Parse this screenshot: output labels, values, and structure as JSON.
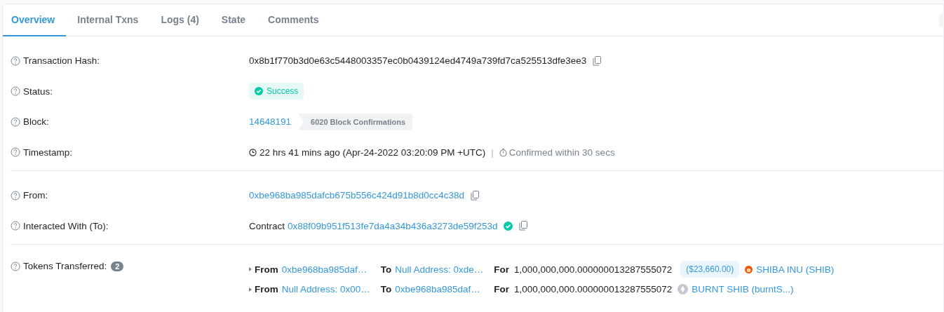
{
  "tabs": [
    {
      "label": "Overview",
      "selected": true
    },
    {
      "label": "Internal Txns",
      "selected": false
    },
    {
      "label": "Logs (4)",
      "selected": false
    },
    {
      "label": "State",
      "selected": false
    },
    {
      "label": "Comments",
      "selected": false
    }
  ],
  "sections": [
    {
      "rows": [
        {
          "label": "Transaction Hash:",
          "kind": "hash",
          "value": "0x8b1f770b3d0e63c5448003357ec0b0439124ed4749a739fd7ca525513dfe3ee3"
        },
        {
          "label": "Status:",
          "kind": "status",
          "value": "Success"
        },
        {
          "label": "Block:",
          "kind": "block",
          "value": "14648191",
          "confirmations": "6020 Block Confirmations"
        },
        {
          "label": "Timestamp:",
          "kind": "timestamp",
          "value": "22 hrs 41 mins ago (Apr-24-2022 03:20:09 PM +UTC)",
          "separator": "|",
          "confirmed": "Confirmed within 30 secs"
        }
      ]
    },
    {
      "rows": [
        {
          "label": "From:",
          "kind": "address",
          "value": "0xbe968ba985dafcb675b556c424d91b8d0cc4c38d"
        },
        {
          "label": "Interacted With (To):",
          "kind": "contract",
          "prefix": "Contract",
          "value": "0x88f09b951f513fe7da4a34b436a3273de59f253d",
          "verified": true
        }
      ]
    },
    {
      "rows": [
        {
          "label": "Tokens Transferred:",
          "kind": "tokens",
          "count": "2",
          "transfers": [
            {
              "from_label": "From",
              "from": "0xbe968ba985daf…",
              "to_label": "To",
              "to": "Null Address: 0xde…",
              "for_label": "For",
              "amount": "1,000,000,000.000000013287555072",
              "usd": "($23,660.00)",
              "token": {
                "kind": "logo",
                "name": "SHIBA INU (SHIB)"
              }
            },
            {
              "from_label": "From",
              "from": "Null Address: 0x00…",
              "to_label": "To",
              "to": "0xbe968ba985daf…",
              "for_label": "For",
              "amount": "1,000,000,000.000000013287555072",
              "token": {
                "kind": "placeholder",
                "name": "BURNT SHIB (burntS...)"
              }
            }
          ]
        }
      ]
    }
  ]
}
